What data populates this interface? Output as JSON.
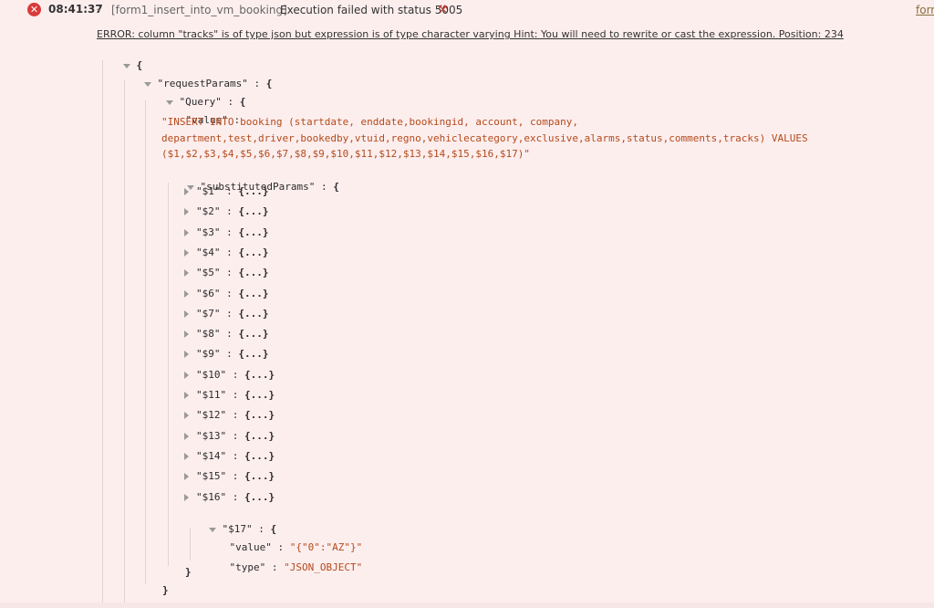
{
  "header": {
    "time": "08:41:37",
    "query_name": "[form1_insert_into_vm_booking]",
    "status_message": "Execution failed with status 5005",
    "right_link": "form"
  },
  "error_line": "ERROR: column \"tracks\" is of type json but expression is of type character varying Hint: You will need to rewrite or cast the expression. Position: 234",
  "tree": {
    "open_brace": "{",
    "request_params_key": "\"requestParams\"",
    "query_key": "\"Query\"",
    "value_key": "\"value\"",
    "sql_line1": "\"INSERT INTO booking (startdate, enddate,bookingid, account, company,",
    "sql_line2": "department,test,driver,bookedby,vtuid,regno,vehiclecategory,exclusive,alarms,status,comments,tracks) VALUES",
    "sql_line3": "($1,$2,$3,$4,$5,$6,$7,$8,$9,$10,$11,$12,$13,$14,$15,$16,$17)\"",
    "substituted_key": "\"substitutedParams\"",
    "collapsed_params": [
      "\"$1\"",
      "\"$2\"",
      "\"$3\"",
      "\"$4\"",
      "\"$5\"",
      "\"$6\"",
      "\"$7\"",
      "\"$8\"",
      "\"$9\"",
      "\"$10\"",
      "\"$11\"",
      "\"$12\"",
      "\"$13\"",
      "\"$14\"",
      "\"$15\"",
      "\"$16\""
    ],
    "collapsed_placeholder": "{...}",
    "p17_key": "\"$17\"",
    "p17_value_key": "\"value\"",
    "p17_value": "\"{\"0\":\"AZ\"}\"",
    "p17_type_key": "\"type\"",
    "p17_type": "\"JSON_OBJECT\"",
    "close_brace": "}",
    "colon": " : "
  }
}
